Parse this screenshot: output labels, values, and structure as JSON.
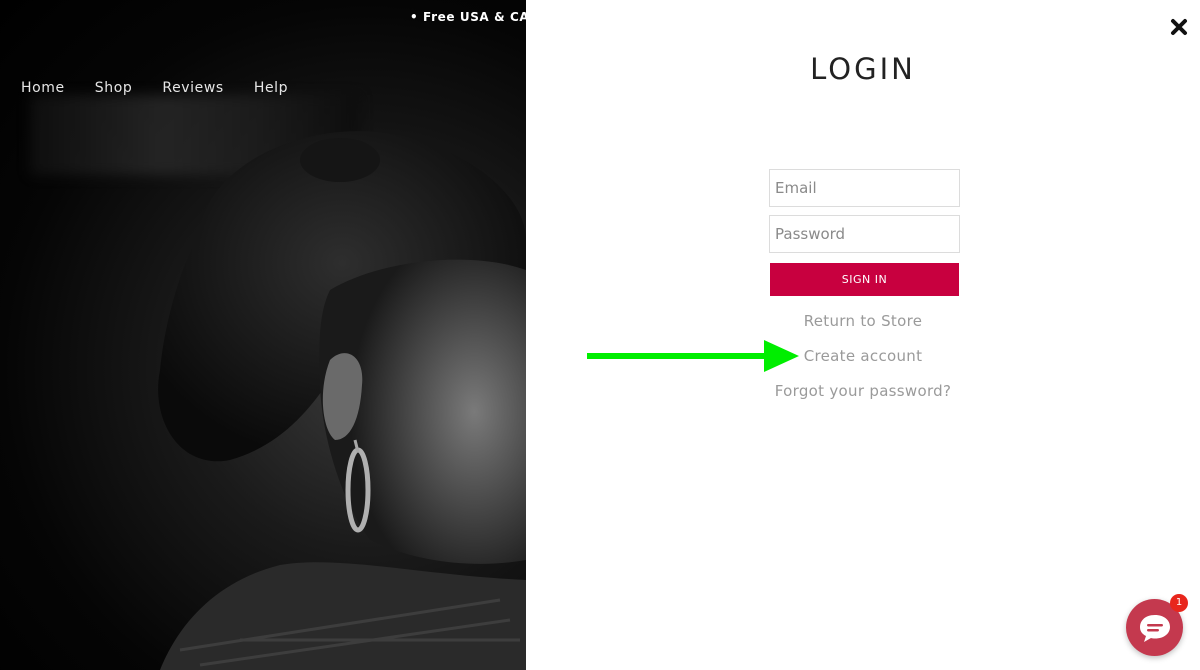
{
  "promo_bar": {
    "text": "• Free USA & CAN Shipping"
  },
  "nav": {
    "items": [
      {
        "label": "Home"
      },
      {
        "label": "Shop"
      },
      {
        "label": "Reviews"
      },
      {
        "label": "Help"
      }
    ]
  },
  "login": {
    "title": "LOGIN",
    "email_placeholder": "Email",
    "password_placeholder": "Password",
    "sign_in_label": "SIGN IN",
    "links": {
      "return_to_store": "Return to Store",
      "create_account": "Create account",
      "forgot_password": "Forgot your password?"
    }
  },
  "chat": {
    "badge_count": "1"
  },
  "icons": {
    "close": "close-icon",
    "chat": "chat-bubble-icon",
    "annotation": "arrow-right-icon"
  },
  "colors": {
    "sign_in_bg": "#c8003f",
    "chat_bg": "#c4394e",
    "badge_bg": "#e8261c",
    "annotation_arrow": "#00ee00"
  }
}
